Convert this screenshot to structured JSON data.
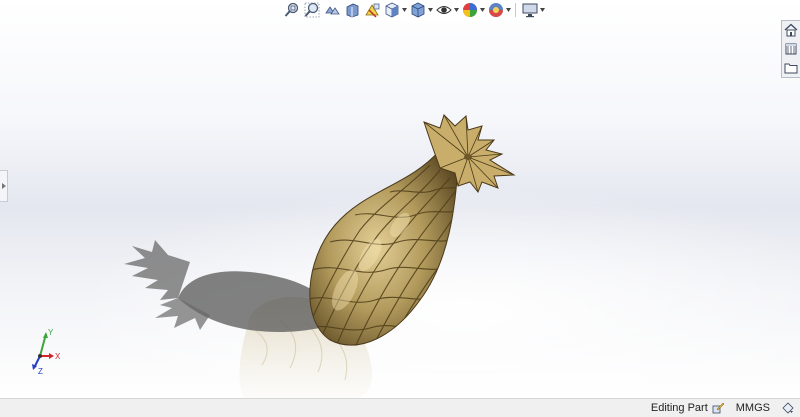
{
  "heads_up_toolbar": {
    "buttons": [
      {
        "id": "zoom-to-fit",
        "icon": "zoom-to-fit-icon"
      },
      {
        "id": "zoom-to-area",
        "icon": "zoom-to-area-icon"
      },
      {
        "id": "previous-view",
        "icon": "previous-view-icon"
      },
      {
        "id": "section-view",
        "icon": "section-view-icon"
      },
      {
        "id": "dynamic-annotation-views",
        "icon": "dynamic-annotation-icon"
      },
      {
        "id": "view-orientation",
        "icon": "view-orientation-icon"
      },
      {
        "id": "display-style",
        "icon": "display-style-icon"
      },
      {
        "id": "hide-show-items",
        "icon": "hide-show-icon"
      },
      {
        "id": "edit-appearance",
        "icon": "edit-appearance-icon"
      },
      {
        "id": "apply-scene",
        "icon": "apply-scene-icon"
      },
      {
        "id": "view-settings",
        "icon": "view-settings-icon"
      }
    ]
  },
  "task_pane": {
    "tabs": [
      {
        "id": "resources",
        "icon": "home-icon"
      },
      {
        "id": "design-library",
        "icon": "design-library-icon"
      },
      {
        "id": "file-explorer",
        "icon": "folder-icon"
      }
    ]
  },
  "colors": {
    "model_gold": "#b29a5c",
    "model_dark": "#5a4722",
    "shadow": "#5e5e5e",
    "axis_x": "#d0262b",
    "axis_y": "#3aa63a",
    "axis_z": "#2540c8"
  },
  "triad": {
    "x_label": "X",
    "y_label": "Y",
    "z_label": "Z"
  },
  "status_bar": {
    "mode": "Editing Part",
    "units": "MMGS"
  }
}
